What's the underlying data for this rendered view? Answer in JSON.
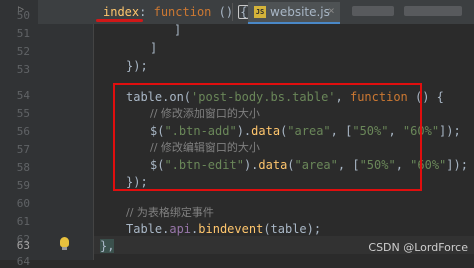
{
  "breadcrumb": {
    "key": "index",
    "colon": ":",
    "fn": "function",
    "rest": " () {"
  },
  "tabs": {
    "active_label": "website.js",
    "active_icon": "JS",
    "close": "×"
  },
  "gutter": {
    "line_numbers": [
      "50",
      "51",
      "52",
      "53",
      "54",
      "55",
      "56",
      "57",
      "58",
      "59",
      "60",
      "61",
      "62",
      "63",
      "64"
    ]
  },
  "code": {
    "l51": "]",
    "l52": "]",
    "l53": "});",
    "l55_a": "table.on(",
    "l55_str": "'post-body.bs.table'",
    "l55_b": ", ",
    "l55_kw": "function",
    "l55_c": " () {",
    "l56": "// 修改添加窗口的大小",
    "l57_a": "$(",
    "l57_s1": "\".btn-add\"",
    "l57_b": ").",
    "l57_fn": "data",
    "l57_c": "(",
    "l57_s2": "\"area\"",
    "l57_d": ", [",
    "l57_s3": "\"50%\"",
    "l57_e": ", ",
    "l57_s4": "\"60%\"",
    "l57_f": "]);",
    "l58": "// 修改编辑窗口的大小",
    "l59_a": "$(",
    "l59_s1": "\".btn-edit\"",
    "l59_b": ").",
    "l59_fn": "data",
    "l59_c": "(",
    "l59_s2": "\"area\"",
    "l59_d": ", [",
    "l59_s3": "\"50%\"",
    "l59_e": ", ",
    "l59_s4": "\"60%\"",
    "l59_f": "]);",
    "l60": "});",
    "l62": "// 为表格绑定事件",
    "l63_a": "Table.",
    "l63_pr": "api",
    "l63_b": ".",
    "l63_fn": "bindevent",
    "l63_c": "(table);",
    "l64": "},"
  },
  "watermark": "CSDN @LordForce",
  "colors": {
    "background": "#2b2b2b",
    "gutter": "#313335",
    "keyword": "#cc7832",
    "string": "#6a8759",
    "comment": "#808080",
    "function": "#ffc66d",
    "highlight_box": "#e00e0e"
  }
}
